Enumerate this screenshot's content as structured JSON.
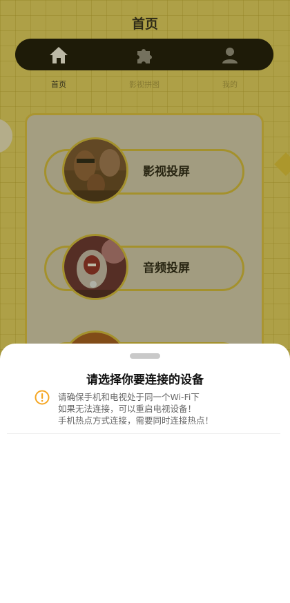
{
  "header": {
    "title": "首页"
  },
  "tabs": [
    {
      "label": "首页",
      "icon": "home-icon",
      "active": true
    },
    {
      "label": "影视拼图",
      "icon": "puzzle-icon",
      "active": false
    },
    {
      "label": "我的",
      "icon": "user-icon",
      "active": false
    }
  ],
  "menu": {
    "items": [
      {
        "label": "影视投屏",
        "icon": "movie-poster-thumbnail"
      },
      {
        "label": "音频投屏",
        "icon": "ironman-thumbnail"
      }
    ]
  },
  "sheet": {
    "title": "请选择你要连接的设备",
    "notice_lines": [
      "请确保手机和电视处于同一个Wi-Fi下",
      "如果无法连接，可以重启电视设备！",
      "手机热点方式连接，需要同时连接热点！"
    ]
  },
  "colors": {
    "accent_yellow": "#E6C93A",
    "tabbar_black": "#000000",
    "warning_orange": "#F5A623"
  }
}
